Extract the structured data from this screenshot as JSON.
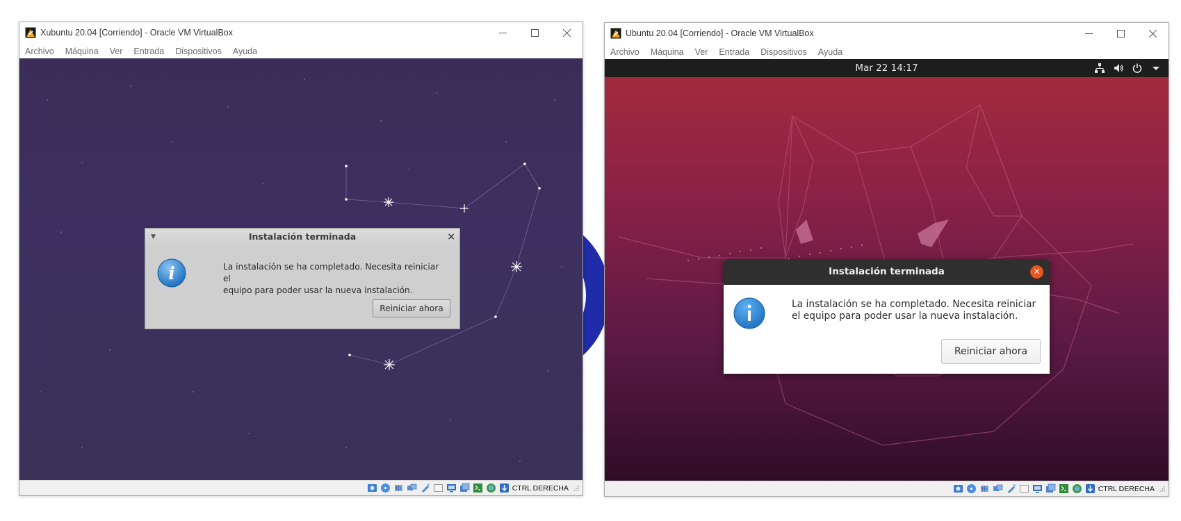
{
  "left_window": {
    "title": "Xubuntu 20.04 [Corriendo] - Oracle VM VirtualBox",
    "menu": [
      "Archivo",
      "Máquina",
      "Ver",
      "Entrada",
      "Dispositivos",
      "Ayuda"
    ],
    "dialog": {
      "title": "Instalación terminada",
      "message_line1": "La instalación se ha completado. Necesita reiniciar el",
      "message_line2": "equipo para poder usar la nueva instalación.",
      "button": "Reiniciar ahora"
    },
    "statusbar": {
      "host_key": "CTRL DERECHA"
    }
  },
  "right_window": {
    "title": "Ubuntu 20.04 [Corriendo] - Oracle VM VirtualBox",
    "menu": [
      "Archivo",
      "Máquina",
      "Ver",
      "Entrada",
      "Dispositivos",
      "Ayuda"
    ],
    "topbar": {
      "clock": "Mar 22  14:17"
    },
    "dialog": {
      "title": "Instalación terminada",
      "message_line1": "La instalación se ha completado. Necesita reiniciar",
      "message_line2": "el equipo para poder usar la nueva instalación.",
      "button": "Reiniciar ahora"
    },
    "statusbar": {
      "host_key": "CTRL DERECHA"
    }
  },
  "colors": {
    "ubuntu_orange": "#e95420",
    "xubuntu_bg": "#3d3060",
    "ubuntu_bg": "#8a2146"
  },
  "icons": [
    "virtualbox-icon",
    "minimize-icon",
    "maximize-icon",
    "close-icon",
    "info-icon",
    "network-icon",
    "volume-icon",
    "power-icon",
    "menu-arrow-icon"
  ]
}
